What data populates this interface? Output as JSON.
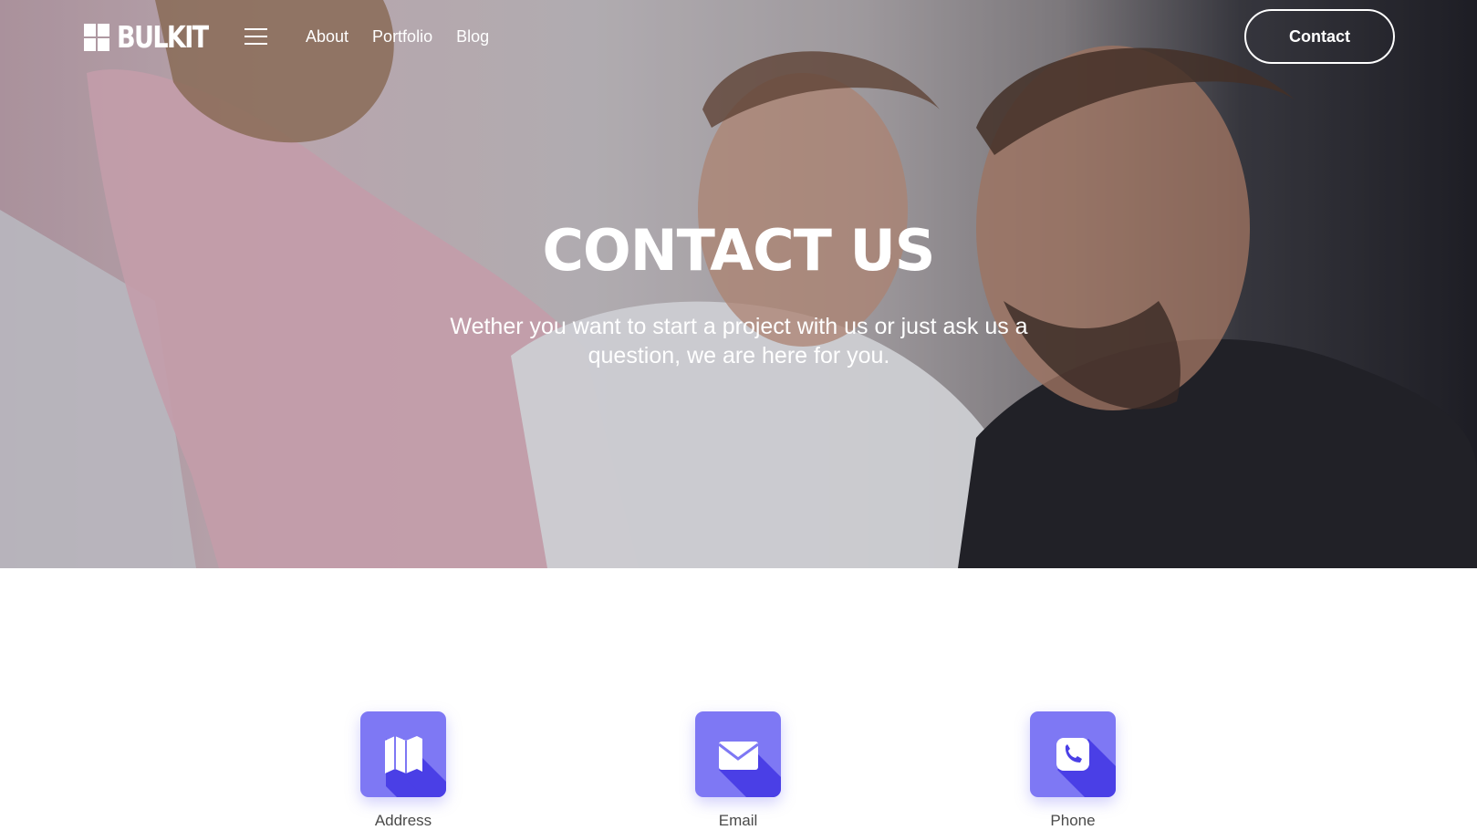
{
  "header": {
    "brand": "BULKIT",
    "nav": [
      "About",
      "Portfolio",
      "Blog"
    ],
    "cta": "Contact"
  },
  "hero": {
    "title": "CONTACT US",
    "subtitle": "Wether you want to start a project with us or just ask us a question, we are here for you."
  },
  "contact_cards": [
    {
      "label": "Address",
      "icon": "map-icon"
    },
    {
      "label": "Email",
      "icon": "envelope-icon"
    },
    {
      "label": "Phone",
      "icon": "phone-icon"
    }
  ],
  "colors": {
    "accent": "#7e78f4",
    "accent_dark": "#4a3fe6",
    "text": "#ffffff"
  }
}
